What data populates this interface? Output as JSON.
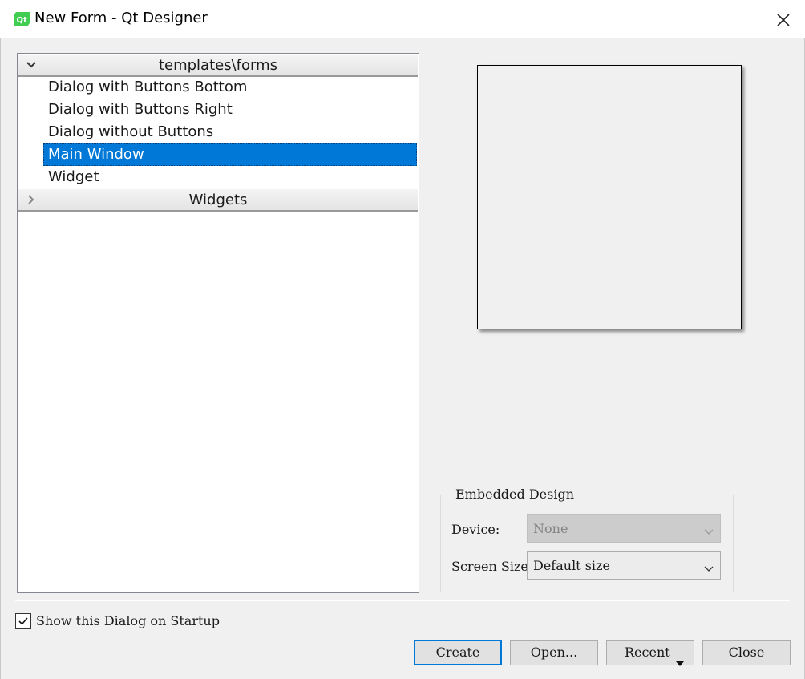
{
  "window": {
    "title": "New Form - Qt Designer",
    "icon": "qt-logo-icon",
    "accent_color": "#0078d7"
  },
  "templates": {
    "categories": [
      {
        "label": "templates\\forms",
        "expanded": true,
        "items": [
          {
            "label": "Dialog with Buttons Bottom",
            "selected": false
          },
          {
            "label": "Dialog with Buttons Right",
            "selected": false
          },
          {
            "label": "Dialog without Buttons",
            "selected": false
          },
          {
            "label": "Main Window",
            "selected": true
          },
          {
            "label": "Widget",
            "selected": false
          }
        ]
      },
      {
        "label": "Widgets",
        "expanded": false,
        "items": []
      }
    ]
  },
  "embedded_design": {
    "title": "Embedded Design",
    "device_label": "Device:",
    "device_value": "None",
    "device_enabled": false,
    "screen_size_label": "Screen Size:",
    "screen_size_value": "Default size"
  },
  "startup": {
    "label": "Show this Dialog on Startup",
    "checked": true
  },
  "buttons": {
    "create": "Create",
    "open": "Open...",
    "recent": "Recent",
    "close": "Close"
  }
}
